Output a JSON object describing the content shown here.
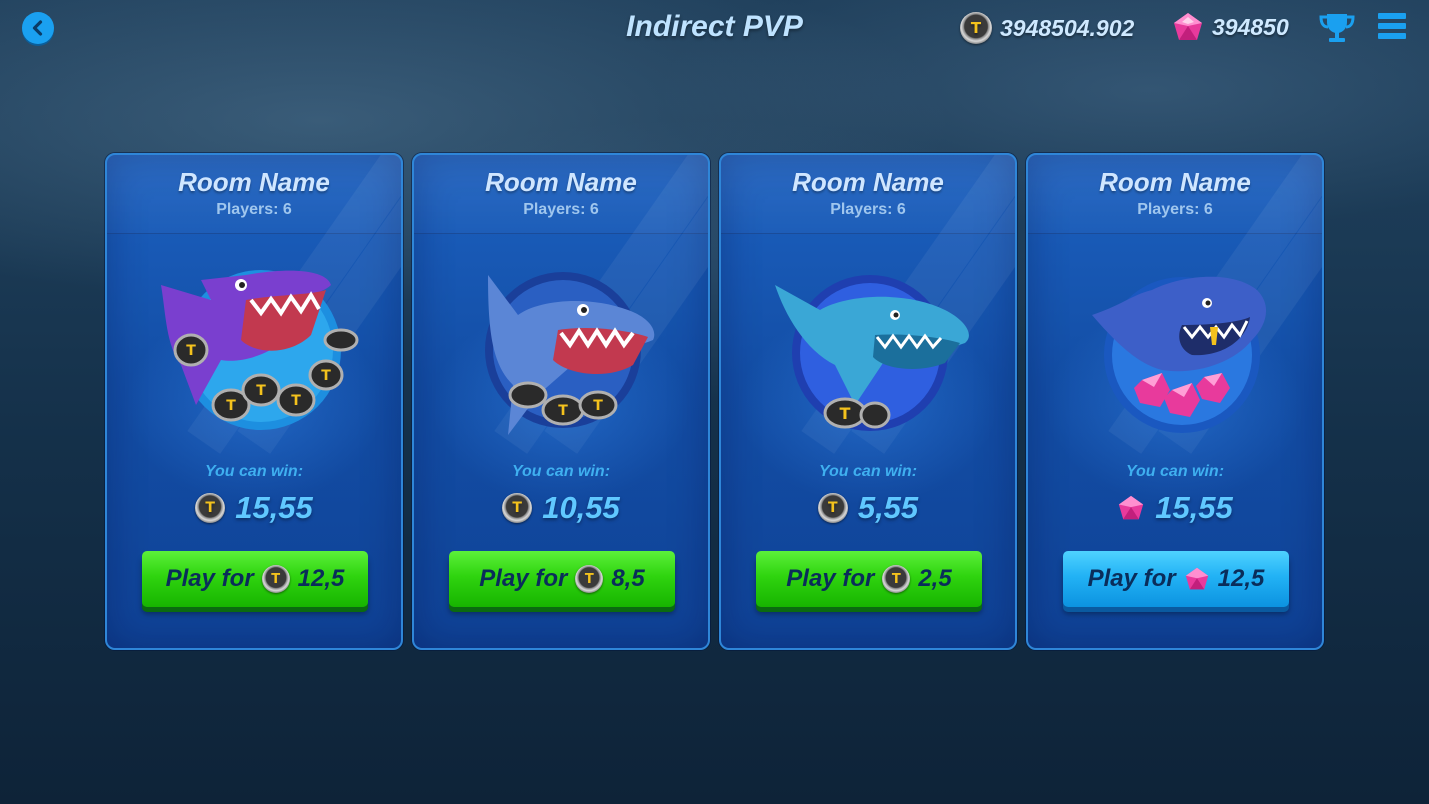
{
  "header": {
    "title": "Indirect PVP",
    "coin_balance": "3948504.902",
    "gem_balance": "394850",
    "back_icon": "chevron-left-icon",
    "trophy_icon": "trophy-icon",
    "menu_icon": "hamburger-menu-icon"
  },
  "rooms": [
    {
      "name": "Room Name",
      "players": "Players:  6",
      "win_label": "You can win:",
      "win_currency": "coin",
      "win_amount": "15,55",
      "play_label": "Play for",
      "play_currency": "coin",
      "play_amount": "12,5",
      "button_color": "green",
      "art": "purple-shark-with-coins"
    },
    {
      "name": "Room Name",
      "players": "Players:  6",
      "win_label": "You can win:",
      "win_currency": "coin",
      "win_amount": "10,55",
      "play_label": "Play for",
      "play_currency": "coin",
      "play_amount": "8,5",
      "button_color": "green",
      "art": "blue-shark-with-coins"
    },
    {
      "name": "Room Name",
      "players": "Players:  6",
      "win_label": "You can win:",
      "win_currency": "coin",
      "win_amount": "5,55",
      "play_label": "Play for",
      "play_currency": "coin",
      "play_amount": "2,5",
      "button_color": "green",
      "art": "teal-shark-with-coins"
    },
    {
      "name": "Room Name",
      "players": "Players:  6",
      "win_label": "You can win:",
      "win_currency": "gem",
      "win_amount": "15,55",
      "play_label": "Play for",
      "play_currency": "gem",
      "play_amount": "12,5",
      "button_color": "blue",
      "art": "grinning-shark-with-gems"
    }
  ],
  "colors": {
    "accent_blue": "#1aa0f0",
    "play_green": "#2fd40f",
    "play_blue": "#22b2f5",
    "gem_pink": "#f04aa8",
    "coin_gold": "#f4c21d"
  }
}
